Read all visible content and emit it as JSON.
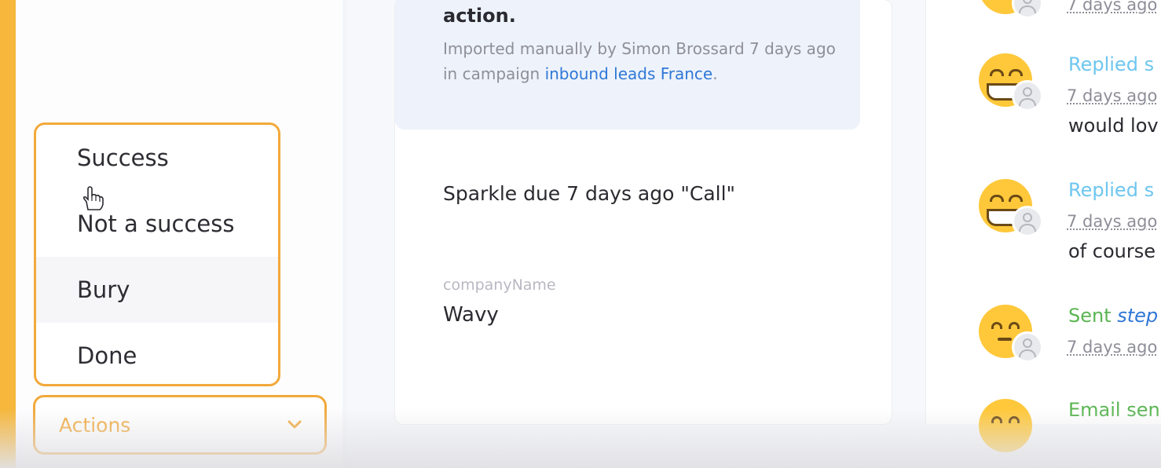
{
  "menu": {
    "items": [
      {
        "label": "Success"
      },
      {
        "label": "Not a success"
      },
      {
        "label": "Bury"
      },
      {
        "label": "Done"
      }
    ]
  },
  "actions_button": {
    "label": "Actions"
  },
  "card": {
    "title": "action.",
    "imported_prefix": "Imported manually by Simon Brossard 7 days ago in campaign ",
    "campaign_link": "inbound leads France",
    "imported_suffix": ".",
    "sparkle": "Sparkle due 7 days ago \"Call\"",
    "field_label": "companyName",
    "field_value": "Wavy"
  },
  "activity": [
    {
      "date": "7 days ago"
    },
    {
      "title": "Replied s",
      "date": "7 days ago",
      "message": "would lov"
    },
    {
      "title": "Replied s",
      "date": "7 days ago",
      "message": "of course"
    },
    {
      "title": "Sent ",
      "title_link": "step",
      "date": "7 days ago"
    },
    {
      "title": "Email sen"
    }
  ],
  "colors": {
    "accent": "#f2a93b",
    "link": "#2f77d6",
    "replied": "#6ec6ef",
    "sent": "#5ab552"
  }
}
